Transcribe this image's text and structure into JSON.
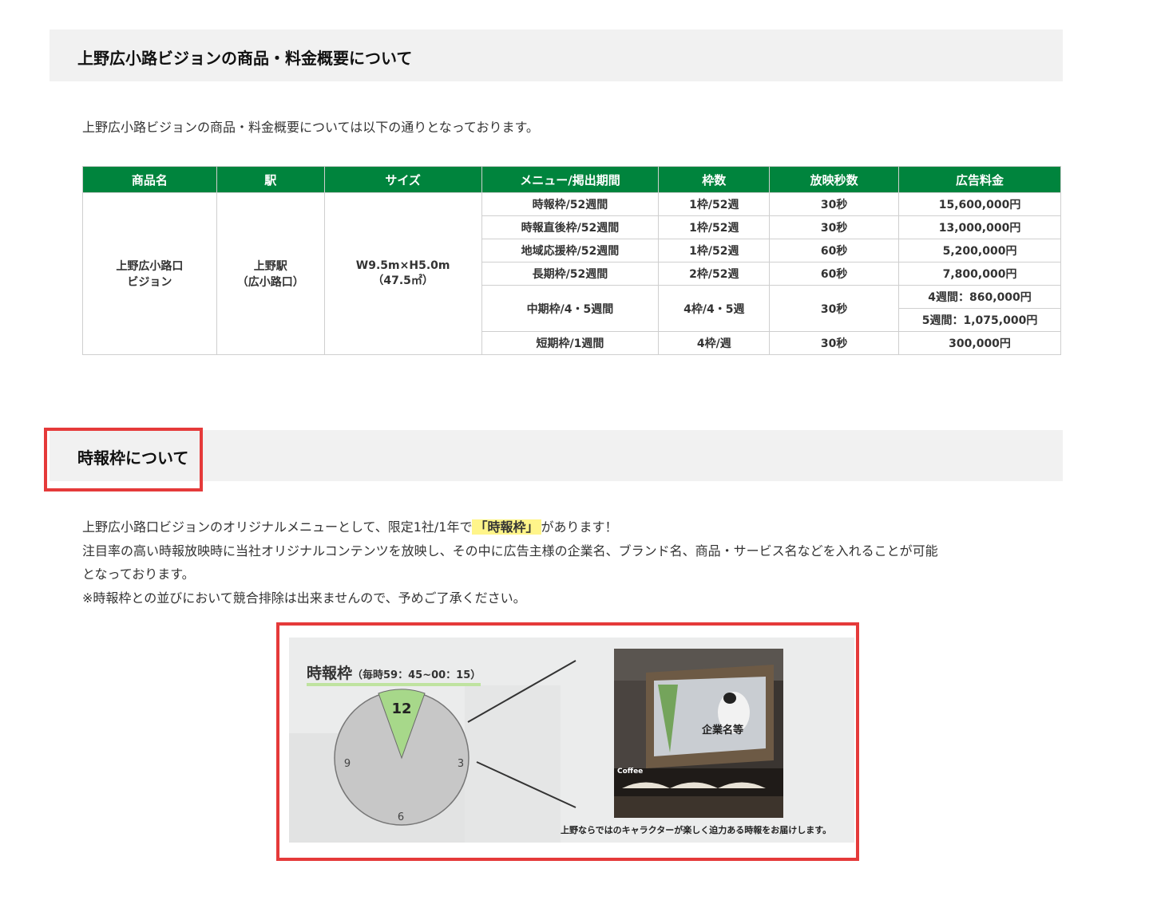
{
  "section1": {
    "heading": "上野広小路ビジョンの商品・料金概要について",
    "intro": "上野広小路ビジョンの商品・料金概要については以下の通りとなっております。"
  },
  "table": {
    "headers": [
      "商品名",
      "駅",
      "サイズ",
      "メニュー/掲出期間",
      "枠数",
      "放映秒数",
      "広告料金"
    ],
    "product": [
      "上野広小路口",
      "ビジョン"
    ],
    "station": [
      "上野駅",
      "（広小路口）"
    ],
    "size": [
      "W9.5m×H5.0m",
      "（47.5㎡）"
    ],
    "rows": [
      {
        "menu": "時報枠/52週間",
        "slots": "1枠/52週",
        "seconds": "30秒",
        "price": "15,600,000円"
      },
      {
        "menu": "時報直後枠/52週間",
        "slots": "1枠/52週",
        "seconds": "30秒",
        "price": "13,000,000円"
      },
      {
        "menu": "地域応援枠/52週間",
        "slots": "1枠/52週",
        "seconds": "60秒",
        "price": "5,200,000円"
      },
      {
        "menu": "長期枠/52週間",
        "slots": "2枠/52週",
        "seconds": "60秒",
        "price": "7,800,000円"
      },
      {
        "menu": "中期枠/4・5週間",
        "slots": "4枠/4・5週",
        "seconds": "30秒",
        "price": "4週間：860,000円",
        "price2": "5週間：1,075,000円"
      },
      {
        "menu": "短期枠/1週間",
        "slots": "4枠/週",
        "seconds": "30秒",
        "price": "300,000円"
      }
    ]
  },
  "section2": {
    "heading": "時報枠について",
    "line1_pre": "上野広小路口ビジョンのオリジナルメニューとして、限定1社/1年で",
    "line1_mark": "「時報枠」",
    "line1_post": "があります！",
    "line2": "注目率の高い時報放映時に当社オリジナルコンテンツを放映し、その中に広告主様の企業名、ブランド名、商品・サービス名などを入れることが可能",
    "line3": "となっております。",
    "line4": "※時報枠との並びにおいて競合排除は出来ませんので、予めご了承ください。"
  },
  "illustration": {
    "title": "時報枠",
    "subtitle": "（毎時59：45~00：15）",
    "clock_12": "12",
    "clock_3": "3",
    "clock_6": "6",
    "clock_9": "9",
    "screen_label": "企業名等",
    "coffee_sign": "Coffee",
    "caption": "上野ならではのキャラクターが楽しく迫力ある時報をお届けします。",
    "colors": {
      "accent_green": "#00843d",
      "wedge_green": "#a7d88a",
      "highlight_red": "#e53a3a"
    }
  }
}
